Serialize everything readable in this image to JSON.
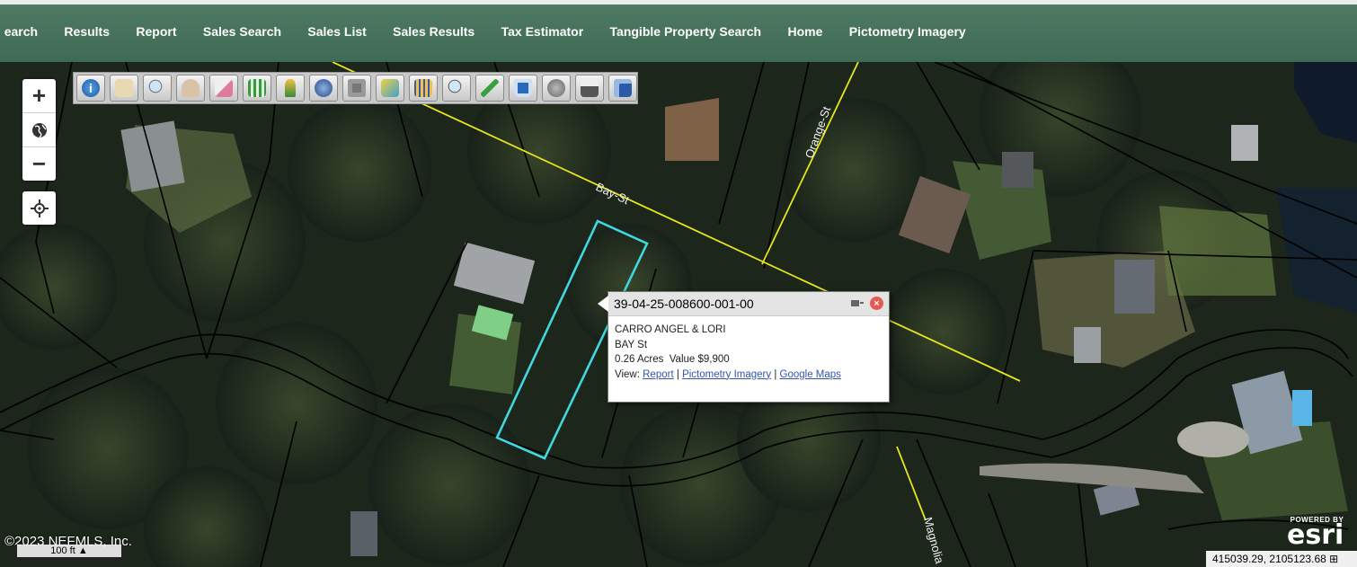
{
  "nav": {
    "items": [
      "earch",
      "Results",
      "Report",
      "Sales Search",
      "Sales List",
      "Sales Results",
      "Tax Estimator",
      "Tangible Property Search",
      "Home",
      "Pictometry Imagery"
    ]
  },
  "map": {
    "streets": [
      "Bay-St",
      "Orange-St",
      "Magnolia"
    ],
    "zoom": {
      "in": "+",
      "out": "−"
    },
    "toolbar": [
      "info-icon",
      "identify-icon",
      "zoom-in-icon",
      "pan-icon",
      "eraser-icon",
      "select-icon",
      "street-view-icon",
      "layers-icon",
      "photo-icon",
      "measure-icon",
      "buffer-icon",
      "search-icon",
      "draw-icon",
      "print-map-icon",
      "selection-icon",
      "printer-icon",
      "save-icon"
    ],
    "colors": {
      "parcel_highlight": "#3fd8e0",
      "road_line": "#e6e61a",
      "nav_bg": "#3f6a55"
    }
  },
  "popup": {
    "title": "39-04-25-008600-001-00",
    "owner": "CARRO ANGEL & LORI",
    "street": "BAY St",
    "acres": "0.26 Acres",
    "value": "Value $9,900",
    "view_label": "View:",
    "links": [
      "Report",
      "Pictometry Imagery",
      "Google Maps"
    ],
    "sep": "|"
  },
  "footer": {
    "copyright": "©2023 NEFMLS, Inc.",
    "scale": "100 ft",
    "coords": "415039.29, 2105123.68",
    "powered": "POWERED BY",
    "esri": "esri"
  }
}
